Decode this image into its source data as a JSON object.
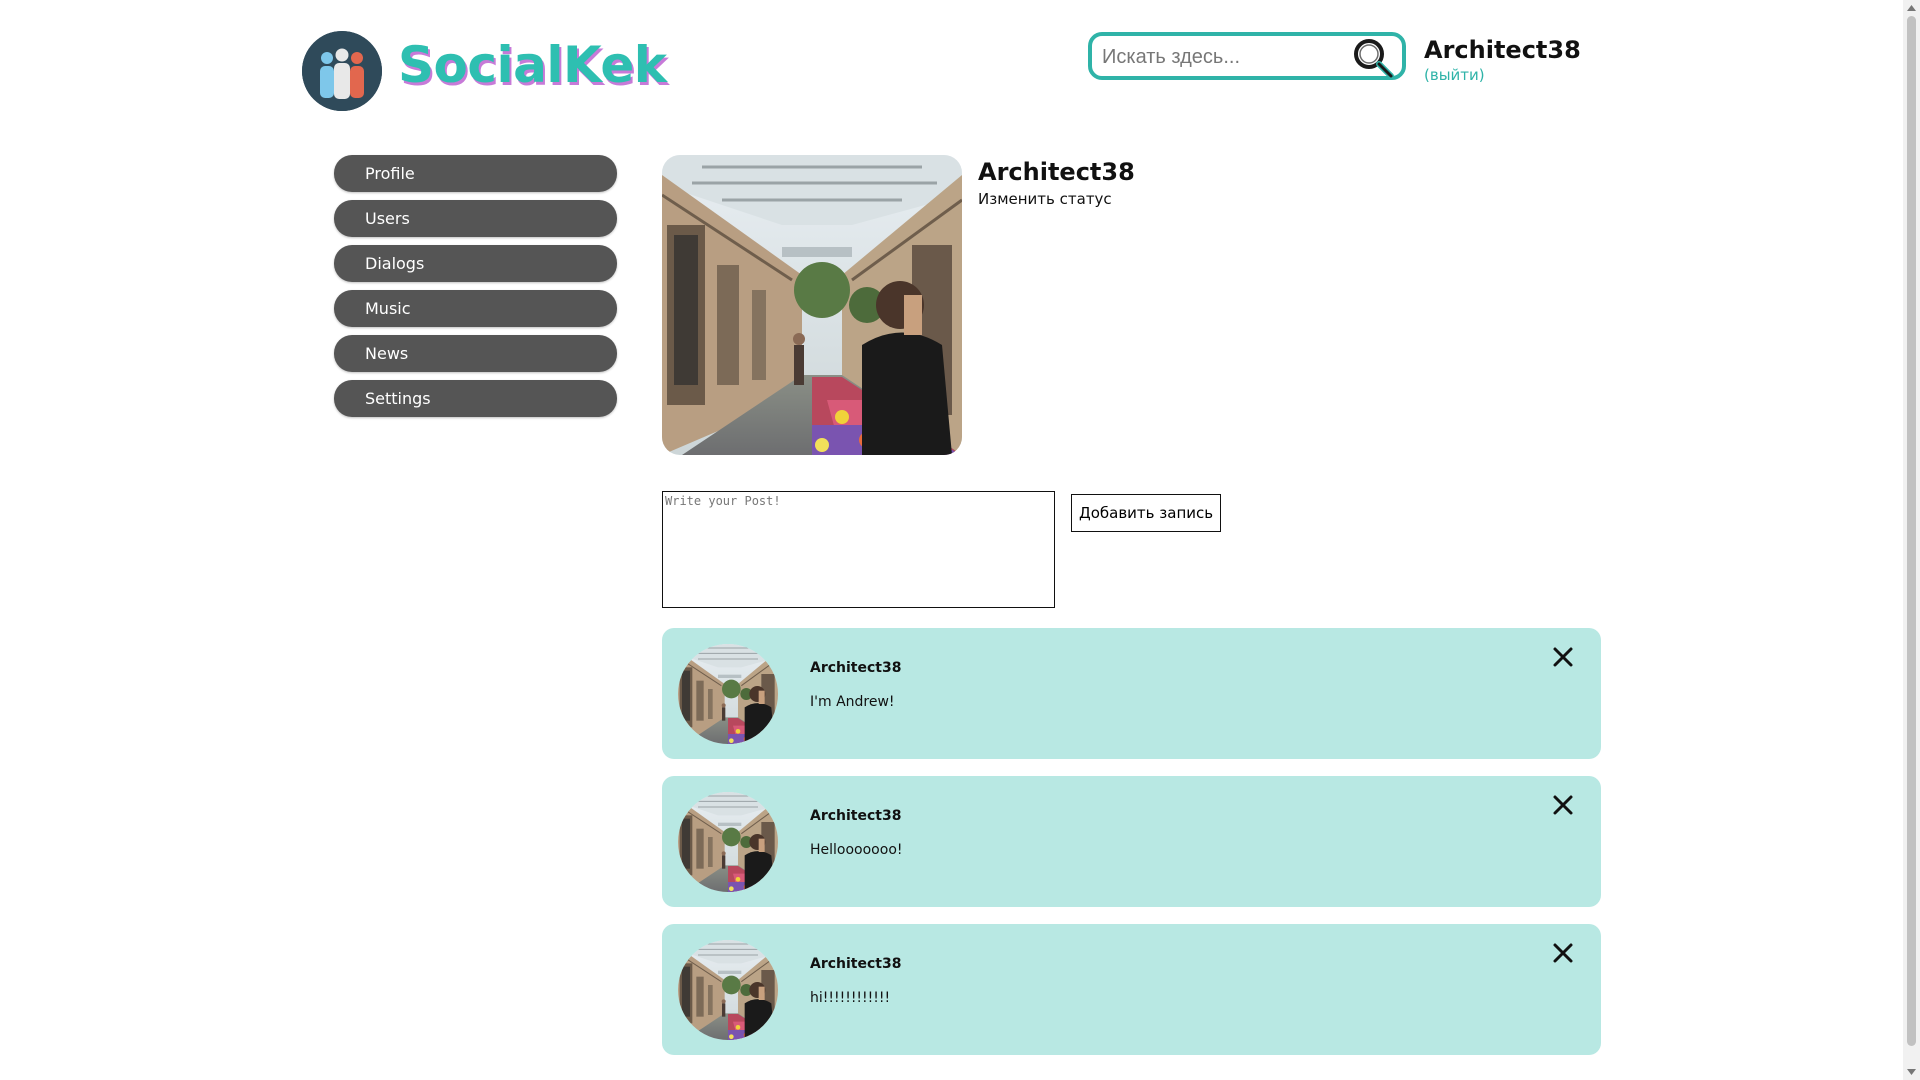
{
  "header": {
    "brand": "SocialKek",
    "search": {
      "placeholder": "Искать здесь...",
      "value": ""
    },
    "user_name": "Architect38",
    "logout_label": "(выйти)"
  },
  "sidebar": {
    "items": [
      {
        "label": "Profile"
      },
      {
        "label": "Users"
      },
      {
        "label": "Dialogs"
      },
      {
        "label": "Music"
      },
      {
        "label": "News"
      },
      {
        "label": "Settings"
      }
    ]
  },
  "profile": {
    "name": "Architect38",
    "status_label": "Изменить статус"
  },
  "composer": {
    "placeholder": "Write your Post!",
    "value": "",
    "submit_label": "Добавить запись"
  },
  "posts": [
    {
      "author": "Architect38",
      "text": "I'm Andrew!"
    },
    {
      "author": "Architect38",
      "text": "Hellooooooo!"
    },
    {
      "author": "Architect38",
      "text": "hi!!!!!!!!!!!!"
    }
  ],
  "colors": {
    "accent": "#2fb3a8",
    "brand_text": "#2ebfb1",
    "brand_shadow": "#c77ad8",
    "nav_background": "#555555",
    "post_background": "#b8e8e3"
  },
  "icons": {
    "logo": "people-group-icon",
    "search": "magnifier-icon",
    "delete": "close-icon"
  }
}
